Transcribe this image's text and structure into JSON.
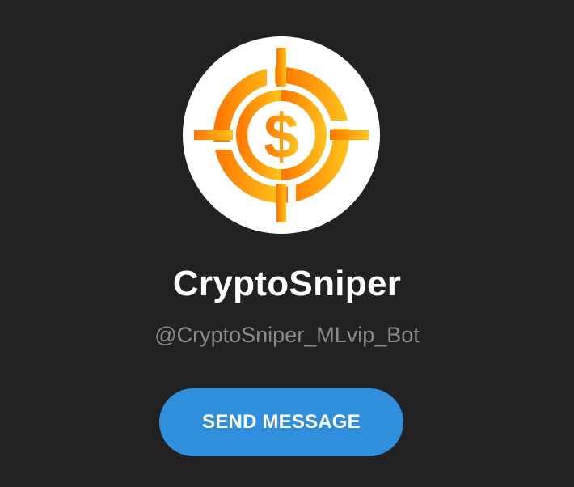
{
  "profile": {
    "name": "CryptoSniper",
    "username": "@CryptoSniper_MLvip_Bot",
    "avatar_icon": "crosshair-dollar-icon"
  },
  "actions": {
    "send_message_label": "SEND MESSAGE"
  },
  "colors": {
    "background": "#222222",
    "accent": "#2f8fdc",
    "username_text": "#8a8a8a",
    "logo_gradient_start": "#ff7a00",
    "logo_gradient_end": "#ffc21a"
  }
}
